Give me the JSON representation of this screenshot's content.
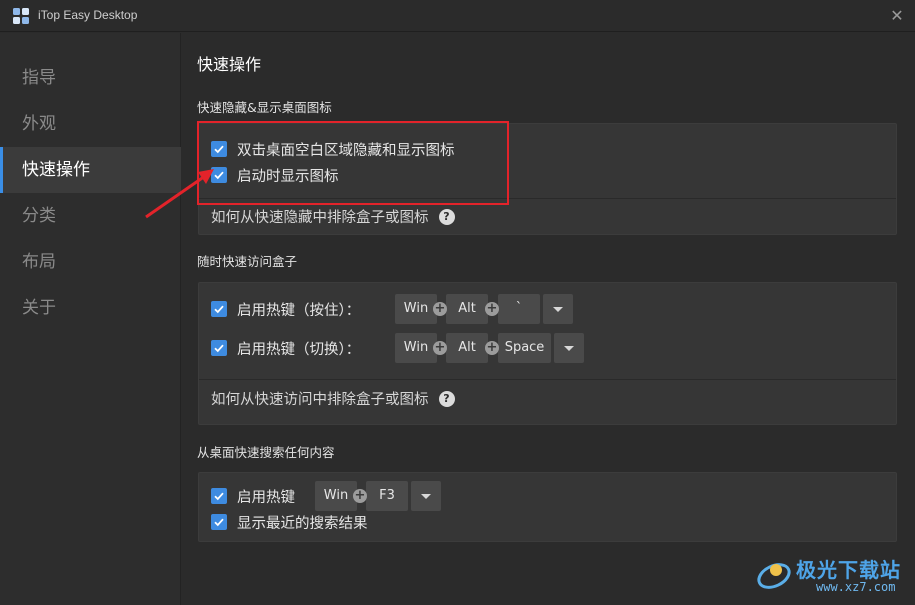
{
  "window": {
    "title": "iTop Easy Desktop",
    "close_label": "✕",
    "accent": "#3a8ee6"
  },
  "sidebar": {
    "items": [
      {
        "label": "指导"
      },
      {
        "label": "外观"
      },
      {
        "label": "快速操作",
        "active": true
      },
      {
        "label": "分类"
      },
      {
        "label": "布局"
      },
      {
        "label": "关于"
      }
    ]
  },
  "main": {
    "page_title": "快速操作",
    "sections": [
      {
        "title": "快速隐藏&显示桌面图标",
        "options": [
          {
            "label": "双击桌面空白区域隐藏和显示图标",
            "checked": true
          },
          {
            "label": "启动时显示图标",
            "checked": true
          }
        ],
        "help": "如何从快速隐藏中排除盒子或图标"
      },
      {
        "title": "随时快速访问盒子",
        "hotkeys": [
          {
            "label": "启用热键（按住）：",
            "checked": true,
            "keys": [
              "Win",
              "Alt",
              "`"
            ]
          },
          {
            "label": "启用热键（切换）：",
            "checked": true,
            "keys": [
              "Win",
              "Alt",
              "Space"
            ]
          }
        ],
        "help": "如何从快速访问中排除盒子或图标"
      },
      {
        "title": "从桌面快速搜索任何内容",
        "hotkey": {
          "label": "启用热键",
          "checked": true,
          "keys": [
            "Win",
            "F3"
          ]
        },
        "option": {
          "label": "显示最近的搜索结果",
          "checked": true
        }
      }
    ]
  },
  "help_icon": "?",
  "annotation": {
    "color": "#e3232a"
  },
  "watermark": {
    "text": "极光下载站",
    "url": "www.xz7.com"
  }
}
